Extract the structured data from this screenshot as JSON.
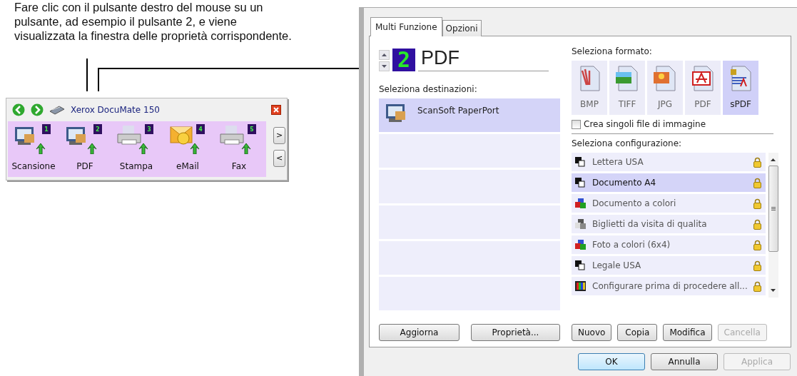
{
  "caption": "Fare clic con il pulsante destro del mouse su un pulsante, ad esempio il pulsante 2, e viene visualizzata la finestra delle proprietà corrispondente.",
  "toolbar": {
    "title": "Xerox DocuMate 150",
    "buttons": [
      {
        "label": "Scansione",
        "number": "1",
        "kind": "scan"
      },
      {
        "label": "PDF",
        "number": "2",
        "kind": "scan"
      },
      {
        "label": "Stampa",
        "number": "3",
        "kind": "printer"
      },
      {
        "label": "eMail",
        "number": "4",
        "kind": "mail"
      },
      {
        "label": "Fax",
        "number": "5",
        "kind": "printer"
      }
    ],
    "scroll_buttons": [
      ">",
      "<"
    ]
  },
  "dialog": {
    "tabs": [
      {
        "label": "Multi Funzione",
        "selected": true
      },
      {
        "label": "Opzioni",
        "selected": false
      }
    ],
    "button_number": "2",
    "button_name": "PDF",
    "destinations_label": "Seleziona destinazioni:",
    "destinations": [
      {
        "label": "ScanSoft PaperPort",
        "selected": true
      }
    ],
    "format_label": "Seleziona formato:",
    "formats": [
      {
        "label": "BMP",
        "selected": false
      },
      {
        "label": "TIFF",
        "selected": false
      },
      {
        "label": "JPG",
        "selected": false
      },
      {
        "label": "PDF",
        "selected": false
      },
      {
        "label": "sPDF",
        "selected": true
      }
    ],
    "single_files": {
      "label": "Crea singoli file di immagine",
      "checked": false
    },
    "config_label": "Seleziona configurazione:",
    "configs": [
      {
        "label": "Lettera USA",
        "selected": false,
        "kind": "bw"
      },
      {
        "label": "Documento A4",
        "selected": true,
        "kind": "bw"
      },
      {
        "label": "Documento a colori",
        "selected": false,
        "kind": "color"
      },
      {
        "label": "Biglietti da visita di qualita",
        "selected": false,
        "kind": "gray"
      },
      {
        "label": "Foto a colori (6x4)",
        "selected": false,
        "kind": "color"
      },
      {
        "label": "Legale USA",
        "selected": false,
        "kind": "bw"
      },
      {
        "label": "Configurare prima di procedere all...",
        "selected": false,
        "kind": "spectrum"
      }
    ],
    "left_buttons": [
      {
        "label": "Aggiorna",
        "disabled": false
      },
      {
        "label": "Proprietà...",
        "disabled": false
      }
    ],
    "right_buttons": [
      {
        "label": "Nuovo",
        "disabled": false
      },
      {
        "label": "Copia",
        "disabled": false
      },
      {
        "label": "Modifica",
        "disabled": false
      },
      {
        "label": "Cancella",
        "disabled": true
      }
    ],
    "footer_buttons": [
      {
        "label": "OK",
        "disabled": false,
        "default": true
      },
      {
        "label": "Annulla",
        "disabled": false,
        "default": false
      },
      {
        "label": "Applica",
        "disabled": true,
        "default": false
      }
    ]
  }
}
